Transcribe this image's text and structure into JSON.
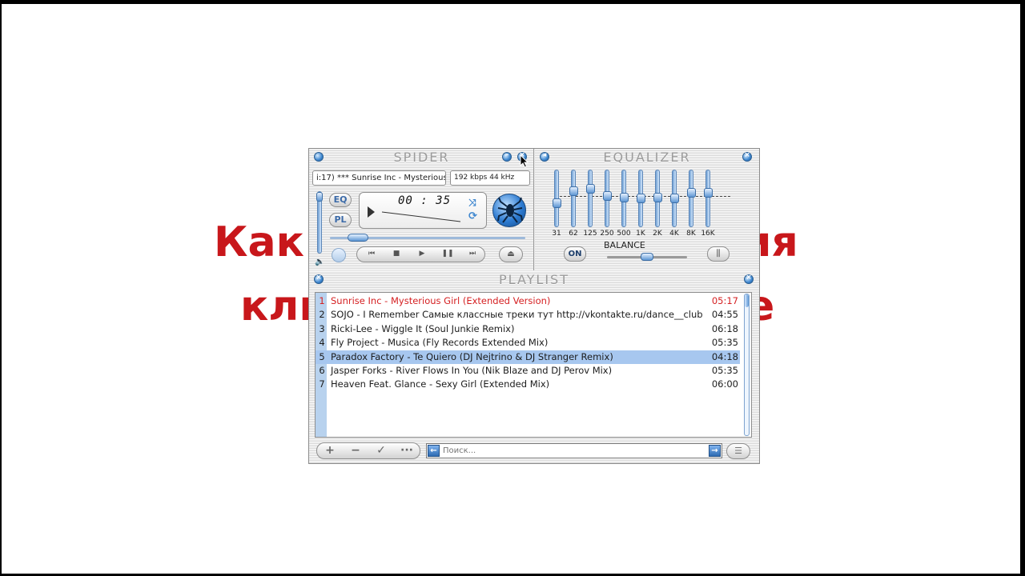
{
  "background": {
    "title_left_line1": "Как",
    "title_right_line1": "ия",
    "title_left_line2": "кли",
    "title_right_line2": "е",
    "title_color": "#c8171b"
  },
  "player": {
    "title": "SPIDER",
    "ticker": "i:17) *** Sunrise Inc - Mysterious",
    "bitrate": "192 kbps 44 kHz",
    "eq_toggle": "EQ",
    "pl_toggle": "PL",
    "time": "00 : 35",
    "logo_icon": "spider-logo-icon",
    "controls": [
      "prev-icon",
      "stop-icon",
      "play-icon",
      "pause-icon",
      "next-icon",
      "eject-icon"
    ]
  },
  "equalizer": {
    "title": "EQUALIZER",
    "bands": [
      {
        "label": "31",
        "level": 0.4
      },
      {
        "label": "62",
        "level": 0.65
      },
      {
        "label": "125",
        "level": 0.7
      },
      {
        "label": "250",
        "level": 0.55
      },
      {
        "label": "500",
        "level": 0.52
      },
      {
        "label": "1K",
        "level": 0.5
      },
      {
        "label": "2K",
        "level": 0.52
      },
      {
        "label": "4K",
        "level": 0.5
      },
      {
        "label": "8K",
        "level": 0.62
      },
      {
        "label": "16K",
        "level": 0.62
      }
    ],
    "on_label": "ON",
    "balance_label": "BALANCE",
    "balance_value": 0.5
  },
  "playlist": {
    "title": "PLAYLIST",
    "tracks": [
      {
        "num": "1",
        "title": "Sunrise Inc - Mysterious Girl (Extended Version)",
        "duration": "05:17",
        "state": "playing"
      },
      {
        "num": "2",
        "title": "SOJO - I Remember   Самые классные треки тут http://vkontakte.ru/dance__club",
        "duration": "04:55",
        "state": ""
      },
      {
        "num": "3",
        "title": "Ricki-Lee - Wiggle It (Soul Junkie Remix)",
        "duration": "06:18",
        "state": ""
      },
      {
        "num": "4",
        "title": "Fly Project - Musica (Fly Records Extended Mix)",
        "duration": "05:35",
        "state": ""
      },
      {
        "num": "5",
        "title": "Paradox Factory - Te Quiero (DJ Nejtrino & DJ Stranger Remix)",
        "duration": "04:18",
        "state": "selected"
      },
      {
        "num": "6",
        "title": "Jasper Forks - River Flows In You (Nik Blaze and DJ Perov Mix)",
        "duration": "05:35",
        "state": ""
      },
      {
        "num": "7",
        "title": "Heaven Feat. Glance - Sexy Girl (Extended Mix)",
        "duration": "06:00",
        "state": ""
      }
    ],
    "search_placeholder": "Поиск...",
    "buttons": [
      "add-icon",
      "remove-icon",
      "check-icon",
      "more-icon"
    ]
  },
  "colors": {
    "accent": "#3d86cf",
    "playing": "#d52022",
    "selected_row": "#a7c7ef"
  }
}
